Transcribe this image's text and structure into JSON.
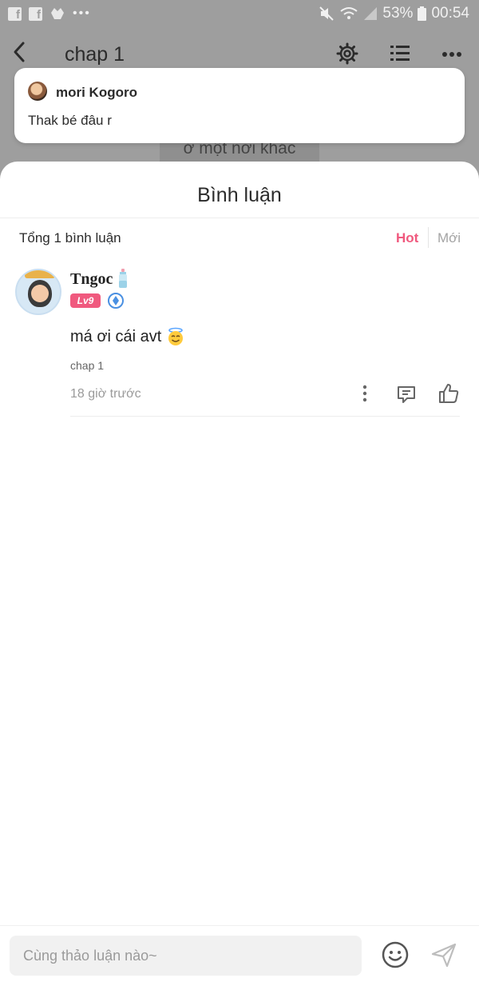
{
  "statusbar": {
    "battery": "53%",
    "time": "00:54",
    "fb_glyph": "f"
  },
  "reader": {
    "title": "chap 1",
    "behind_text": "ở một nơi khác"
  },
  "notification": {
    "user": "mori Kogoro",
    "message": "Thak bé đâu r"
  },
  "comments_sheet": {
    "heading": "Bình luận",
    "total": "Tổng 1 bình luận",
    "tabs": {
      "hot": "Hot",
      "new": "Mới"
    },
    "comment": {
      "username": "Tngoc",
      "level": "Lv9",
      "text": "má ơi cái avt",
      "chapter": "chap 1",
      "time": "18 giờ trước"
    }
  },
  "composer": {
    "placeholder": "Cùng thảo luận nào~"
  },
  "colors": {
    "accent": "#f0597e",
    "overlay": "#9e9e9e"
  }
}
